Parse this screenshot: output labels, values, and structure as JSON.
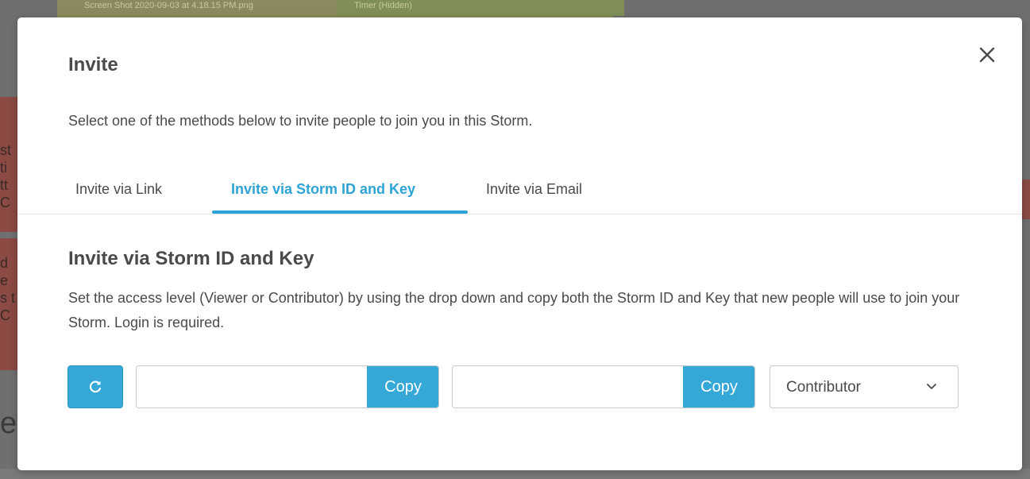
{
  "background": {
    "chip_one": "Screen Shot 2020-09-03 at 4.18.15 PM.png",
    "chip_two": "Timer (Hidden)",
    "left_fragment_a": "st ti tt C",
    "left_fragment_b": "d e s t C",
    "left_big": "e"
  },
  "modal": {
    "title": "Invite",
    "subtitle": "Select one of the methods below to invite people to join you in this Storm.",
    "close_icon": "close-icon"
  },
  "tabs": [
    {
      "label": "Invite via Link",
      "active": false
    },
    {
      "label": "Invite via Storm ID and Key",
      "active": true
    },
    {
      "label": "Invite via Email",
      "active": false
    }
  ],
  "section": {
    "title": "Invite via Storm ID and Key",
    "description": "Set the access level (Viewer or Contributor) by using the drop down and copy both the Storm ID and Key that new people will use to join your Storm. Login is required."
  },
  "controls": {
    "refresh_icon": "refresh-icon",
    "storm_id": {
      "value": "",
      "copy_label": "Copy"
    },
    "storm_key": {
      "value": "",
      "copy_label": "Copy"
    },
    "access_level": {
      "selected": "Contributor",
      "icon": "chevron-down-icon"
    }
  },
  "colors": {
    "accent": "#35a8d8",
    "tab_active": "#2ea3d5",
    "text": "#4a4a4a"
  }
}
